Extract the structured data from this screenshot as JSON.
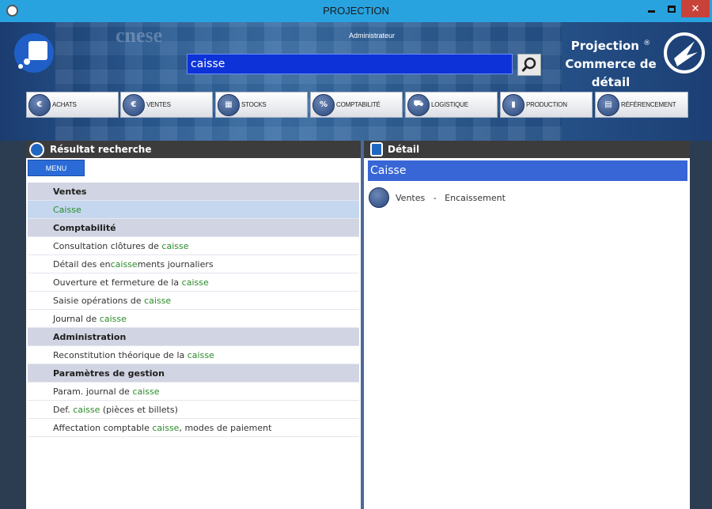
{
  "window": {
    "title": "PROJECTION"
  },
  "header": {
    "user": "Administrateur",
    "search_value": "caisse",
    "brand_line1": "Projection",
    "brand_reg": "®",
    "brand_line2": "Commerce de",
    "brand_line3": "détail",
    "ghost_text": "cnese"
  },
  "modules": [
    {
      "label": "ACHATS",
      "icon": "achats-icon"
    },
    {
      "label": "VENTES",
      "icon": "ventes-icon"
    },
    {
      "label": "STOCKS",
      "icon": "stocks-icon"
    },
    {
      "label": "COMPTABILITÉ",
      "icon": "comptabilite-icon"
    },
    {
      "label": "LOGISTIQUE",
      "icon": "logistique-icon"
    },
    {
      "label": "PRODUCTION",
      "icon": "production-icon"
    },
    {
      "label": "RÉFÉRENCEMENT",
      "icon": "referencement-icon"
    }
  ],
  "left_panel": {
    "title": "Résultat recherche",
    "menu_label": "MENU",
    "rows": [
      {
        "type": "cat",
        "parts": [
          [
            "Ventes",
            false
          ]
        ]
      },
      {
        "type": "sel",
        "parts": [
          [
            "Caisse",
            true
          ]
        ]
      },
      {
        "type": "cat",
        "parts": [
          [
            "Comptabilité",
            false
          ]
        ]
      },
      {
        "type": "item",
        "parts": [
          [
            "Consultation clôtures de ",
            false
          ],
          [
            "caisse",
            true
          ]
        ]
      },
      {
        "type": "item",
        "parts": [
          [
            "Détail des en",
            false
          ],
          [
            "caisse",
            true
          ],
          [
            "ments journaliers",
            false
          ]
        ]
      },
      {
        "type": "item",
        "parts": [
          [
            "Ouverture et fermeture de la ",
            false
          ],
          [
            "caisse",
            true
          ]
        ]
      },
      {
        "type": "item",
        "parts": [
          [
            "Saisie opérations de ",
            false
          ],
          [
            "caisse",
            true
          ]
        ]
      },
      {
        "type": "item",
        "parts": [
          [
            "Journal de ",
            false
          ],
          [
            "caisse",
            true
          ]
        ]
      },
      {
        "type": "cat",
        "parts": [
          [
            "Administration",
            false
          ]
        ]
      },
      {
        "type": "item",
        "parts": [
          [
            "Reconstitution théorique de la ",
            false
          ],
          [
            "caisse",
            true
          ]
        ]
      },
      {
        "type": "cat",
        "parts": [
          [
            "Paramètres de gestion",
            false
          ]
        ]
      },
      {
        "type": "item",
        "parts": [
          [
            "Param. journal de ",
            false
          ],
          [
            "caisse",
            true
          ]
        ]
      },
      {
        "type": "item",
        "parts": [
          [
            "Def. ",
            false
          ],
          [
            "caisse",
            true
          ],
          [
            " (pièces et billets)",
            false
          ]
        ]
      },
      {
        "type": "item",
        "parts": [
          [
            "Affectation comptable ",
            false
          ],
          [
            "caisse",
            true
          ],
          [
            ", modes de paiement",
            false
          ]
        ]
      }
    ]
  },
  "right_panel": {
    "title": "Détail",
    "detail_title": "Caisse",
    "detail_item": "Ventes   -   Encaissement"
  },
  "colors": {
    "title_bar": "#29a3e0",
    "search_bg": "#0d33d8",
    "highlight": "#2a8a2a",
    "detail_title_bg": "#3866d6",
    "category_bg": "#d1d4e2",
    "selected_bg": "#c4d7ef"
  }
}
